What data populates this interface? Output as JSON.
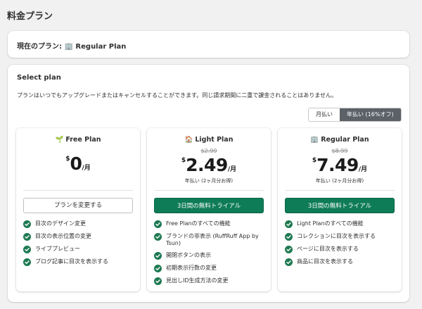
{
  "page": {
    "title": "料金プラン"
  },
  "current": {
    "label": "現在のプラン: ",
    "icon": "🏢",
    "plan": "Regular Plan"
  },
  "select": {
    "title": "Select plan",
    "description": "プランはいつでもアップグレードまたはキャンセルすることができます。同じ請求期間に二重で課金されることはありません。",
    "toggle": {
      "monthly": "月払い",
      "yearly": "年払い (16%オフ)",
      "active": "yearly"
    }
  },
  "plans": [
    {
      "icon": "🌱",
      "name": "Free Plan",
      "old_price": "",
      "currency": "$",
      "price": "0",
      "per": "/月",
      "billing": "",
      "button": "プランを変更する",
      "features": [
        "目次のデザイン変更",
        "目次の表示位置の変更",
        "ライブプレビュー",
        "ブログ記事に目次を表示する"
      ]
    },
    {
      "icon": "🏠",
      "name": "Light Plan",
      "old_price": "$2.99",
      "currency": "$",
      "price": "2.49",
      "per": "/月",
      "billing": "年払い (2ヶ月分お得)",
      "button": "3日間の無料トライアル",
      "features": [
        "Free Planのすべての機能",
        "ブランドの非表示 (RuffRuff App by Tsun)",
        "開閉ボタンの表示",
        "初期表示行数の変更",
        "見出しID生成方法の変更"
      ]
    },
    {
      "icon": "🏢",
      "name": "Regular Plan",
      "old_price": "$8.99",
      "currency": "$",
      "price": "7.49",
      "per": "/月",
      "billing": "年払い (2ヶ月分お得)",
      "button": "3日間の無料トライアル",
      "features": [
        "Light Planのすべての機能",
        "コレクションに目次を表示する",
        "ページに目次を表示する",
        "商品に目次を表示する"
      ]
    }
  ],
  "colors": {
    "primary": "#0e7c56",
    "check": "#1f7a52",
    "toggle_active": "#5c6168"
  }
}
